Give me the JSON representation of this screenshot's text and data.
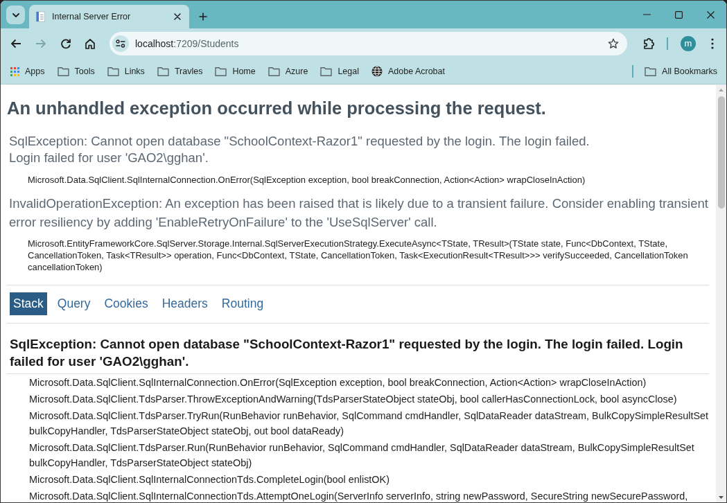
{
  "browser": {
    "tabs": [
      {
        "title": "Internal Server Error",
        "selected": true
      }
    ],
    "forward_button": {
      "disabled": true
    },
    "address_bar": {
      "host": "localhost",
      "path": ":7209/Students"
    },
    "profile": {
      "initial": "m"
    },
    "bookmarks": [
      {
        "kind": "apps",
        "label": "Apps"
      },
      {
        "kind": "folder",
        "label": "Tools"
      },
      {
        "kind": "folder",
        "label": "Links"
      },
      {
        "kind": "folder",
        "label": "Travles"
      },
      {
        "kind": "folder",
        "label": "Home"
      },
      {
        "kind": "folder",
        "label": "Azure"
      },
      {
        "kind": "folder",
        "label": "Legal"
      },
      {
        "kind": "site",
        "label": "Adobe Acrobat"
      }
    ],
    "all_bookmarks": {
      "label": "All Bookmarks"
    }
  },
  "page": {
    "title": "An unhandled exception occurred while processing the request.",
    "exceptions": [
      {
        "message_lines": [
          "SqlException: Cannot open database \"SchoolContext-Razor1\" requested by the login. The login failed.",
          "Login failed for user 'GAO2\\gghan'."
        ],
        "location": "Microsoft.Data.SqlClient.SqlInternalConnection.OnError(SqlException exception, bool breakConnection, Action<Action> wrapCloseInAction)"
      },
      {
        "message_lines": [
          "InvalidOperationException: An exception has been raised that is likely due to a transient failure. Consider enabling transient error resiliency by adding 'EnableRetryOnFailure' to the 'UseSqlServer' call."
        ],
        "location": "Microsoft.EntityFrameworkCore.SqlServer.Storage.Internal.SqlServerExecutionStrategy.ExecuteAsync<TState, TResult>(TState state, Func<DbContext, TState, CancellationToken, Task<TResult>> operation, Func<DbContext, TState, CancellationToken, Task<ExecutionResult<TResult>>> verifySucceeded, CancellationToken cancellationToken)"
      }
    ],
    "tabs": [
      {
        "label": "Stack",
        "selected": true
      },
      {
        "label": "Query",
        "selected": false
      },
      {
        "label": "Cookies",
        "selected": false
      },
      {
        "label": "Headers",
        "selected": false
      },
      {
        "label": "Routing",
        "selected": false
      }
    ],
    "stack": {
      "heading": "SqlException: Cannot open database \"SchoolContext-Razor1\" requested by the login. The login failed. Login failed for user 'GAO2\\gghan'.",
      "frames": [
        "Microsoft.Data.SqlClient.SqlInternalConnection.OnError(SqlException exception, bool breakConnection, Action<Action> wrapCloseInAction)",
        "Microsoft.Data.SqlClient.TdsParser.ThrowExceptionAndWarning(TdsParserStateObject stateObj, bool callerHasConnectionLock, bool asyncClose)",
        "Microsoft.Data.SqlClient.TdsParser.TryRun(RunBehavior runBehavior, SqlCommand cmdHandler, SqlDataReader dataStream, BulkCopySimpleResultSet bulkCopyHandler, TdsParserStateObject stateObj, out bool dataReady)",
        "Microsoft.Data.SqlClient.TdsParser.Run(RunBehavior runBehavior, SqlCommand cmdHandler, SqlDataReader dataStream, BulkCopySimpleResultSet bulkCopyHandler, TdsParserStateObject stateObj)",
        "Microsoft.Data.SqlClient.SqlInternalConnectionTds.CompleteLogin(bool enlistOK)",
        "Microsoft.Data.SqlClient.SqlInternalConnectionTds.AttemptOneLogin(ServerInfo serverInfo, string newPassword, SecureString newSecurePassword,"
      ]
    }
  }
}
